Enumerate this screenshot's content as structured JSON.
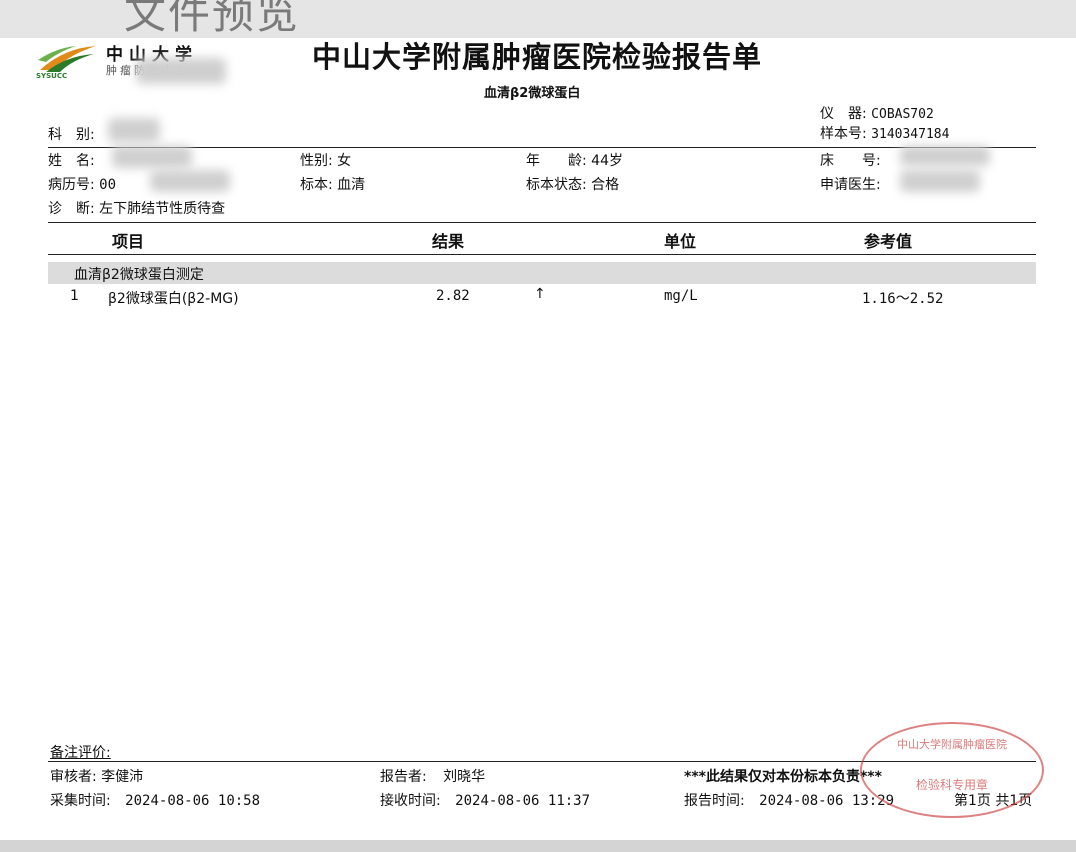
{
  "page_title": "文件预览",
  "logo": {
    "name": "中山大学",
    "sub": "肿瘤防治中心",
    "abbr": "SYSUCC"
  },
  "report": {
    "hospital_title": "中山大学附属肿瘤医院检验报告单",
    "subtitle": "血清β2微球蛋白"
  },
  "instrument": {
    "label": "仪　器:",
    "value": "COBAS702"
  },
  "sample_no": {
    "label": "样本号:",
    "value": "3140347184"
  },
  "patient": {
    "dept_label": "科　别:",
    "name_label": "姓　名:",
    "gender": "性别: 女",
    "age_label": "年　　龄:",
    "age_value": "44岁",
    "bed_label": "床　　号:",
    "record_label": "病历号:",
    "record_value": "00",
    "specimen": "标本: 血清",
    "specimen_status": "标本状态: 合格",
    "doctor_label": "申请医生:",
    "diagnosis_label": "诊　断:",
    "diagnosis_value": "左下肺结节性质待查"
  },
  "table": {
    "headers": {
      "item": "项目",
      "result": "结果",
      "unit": "单位",
      "reference": "参考值"
    },
    "section": "血清β2微球蛋白测定",
    "rows": [
      {
        "no": "1",
        "item": "β2微球蛋白(β2-MG)",
        "result": "2.82",
        "flag": "↑",
        "unit": "mg/L",
        "reference": "1.16～2.52"
      }
    ]
  },
  "footer": {
    "remark_label": "备注评价:",
    "reviewer": "审核者:  李健沛",
    "reporter_label": "报告者:",
    "reporter_value": "刘晓华",
    "notice": "***此结果仅对本份标本负责***",
    "collect_label": "采集时间:",
    "collect_time": "2024-08-06 10:58",
    "receive_label": "接收时间:",
    "receive_time": "2024-08-06 11:37",
    "report_label": "报告时间:",
    "report_time": "2024-08-06 13:29",
    "page_info": "第1页 共1页"
  },
  "stamp": {
    "text_top": "中山大学附属肿瘤医院",
    "text_bottom": "检验科专用章"
  },
  "colors": {
    "stamp": "#c83c3c",
    "logo_green": "#2a7a2a",
    "logo_orange": "#e08a1a"
  }
}
